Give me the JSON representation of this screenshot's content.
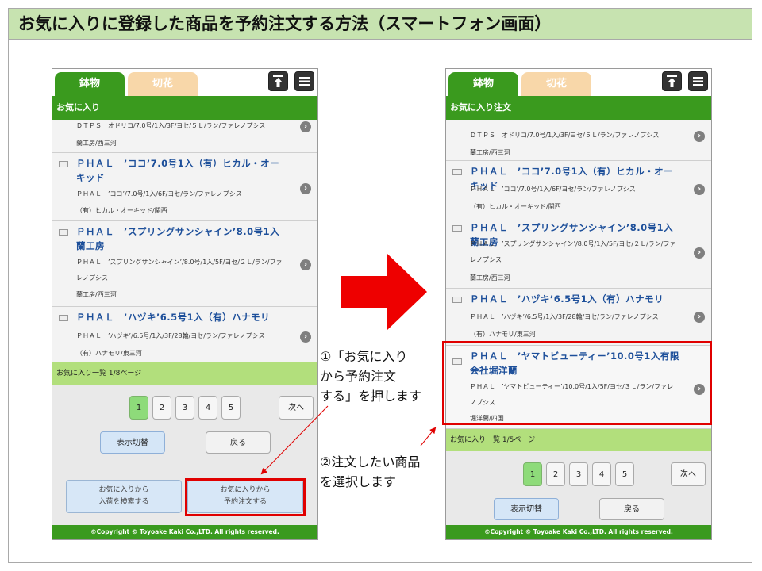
{
  "title": "お気に入りに登録した商品を予約注文する方法（スマートフォン画面）",
  "colors": {
    "green": "#3a9a1e",
    "light_green": "#b2df7c",
    "orange_tab": "#f8d7a9",
    "link_blue": "#1d4f9a",
    "red": "#e00000"
  },
  "annotations": {
    "step1": [
      "①「お気に入り",
      "から予約注文",
      "する」を押します"
    ],
    "step2": [
      "②注文したい商品",
      "を選択します"
    ]
  },
  "left_screen": {
    "tabs": [
      "鉢物",
      "切花"
    ],
    "icons": [
      "arrow-up-icon",
      "menu-icon"
    ],
    "section_title": "お気に入り",
    "items": [
      {
        "title": "",
        "lines": [
          "ＤＴＰＳ　オドリコ/7.0号/1入/3F/ヨセ/５Ｌ/ラン/ファレノプシス",
          "蘭工房/西三河"
        ]
      },
      {
        "title": "ＰＨＡＬ　’ココ’7.0号1入（有）ヒカル・オーキッド",
        "lines": [
          "ＰＨＡＬ　’ココ’/7.0号/1入/6F/ヨセ/ラン/ファレノプシス",
          "（有）ヒカル・オーキッド/関西"
        ]
      },
      {
        "title": "ＰＨＡＬ　’スプリングサンシャイン’8.0号1入蘭工房",
        "lines": [
          "ＰＨＡＬ　’スプリングサンシャイン’/8.0号/1入/5F/ヨセ/２Ｌ/ラン/ファレノプシス",
          "蘭工房/西三河"
        ]
      },
      {
        "title": "ＰＨＡＬ　’ハヅキ’6.5号1入（有）ハナモリ",
        "lines": [
          "ＰＨＡＬ　’ハヅキ’/6.5号/1入/3F/28輪/ヨセ/ラン/ファレノプシス",
          "（有）ハナモリ/東三河"
        ]
      }
    ],
    "page_info": "お気に入り一覧 1/8ページ",
    "pages": [
      "1",
      "2",
      "3",
      "4",
      "5"
    ],
    "next": "次へ",
    "toggle_btn": "表示切替",
    "back_btn": "戻る",
    "search_btn": [
      "お気に入りから",
      "入荷を検索する"
    ],
    "order_btn": [
      "お気に入りから",
      "予約注文する"
    ],
    "copyright": "©Copyright © Toyoake Kaki Co.,LTD. All rights reserved."
  },
  "right_screen": {
    "tabs": [
      "鉢物",
      "切花"
    ],
    "icons": [
      "arrow-up-icon",
      "menu-icon"
    ],
    "section_title": "お気に入り注文",
    "items": [
      {
        "title": "",
        "lines": [
          "ＤＴＰＳ　オドリコ/7.0号/1入/3F/ヨセ/５Ｌ/ラン/ファレノプシス",
          "蘭工房/西三河"
        ]
      },
      {
        "title": "ＰＨＡＬ　’ココ’7.0号1入（有）ヒカル・オーキッド",
        "lines": [
          "ＰＨＡＬ　’ココ’/7.0号/1入/6F/ヨセ/ラン/ファレノプシス",
          "（有）ヒカル・オーキッド/関西"
        ]
      },
      {
        "title": "ＰＨＡＬ　’スプリングサンシャイン’8.0号1入蘭工房",
        "lines": [
          "ＰＨＡＬ　’スプリングサンシャイン’/8.0号/1入/5F/ヨセ/２Ｌ/ラン/ファレノプシス",
          "蘭工房/西三河"
        ]
      },
      {
        "title": "ＰＨＡＬ　’ハヅキ’6.5号1入（有）ハナモリ",
        "lines": [
          "ＰＨＡＬ　’ハヅキ’/6.5号/1入/3F/28輪/ヨセ/ラン/ファレノプシス",
          "（有）ハナモリ/東三河"
        ]
      },
      {
        "title": "ＰＨＡＬ　’ヤマトビューティー’10.0号1入有限会社堀洋蘭",
        "lines": [
          "ＰＨＡＬ　’ヤマトビューティー’/10.0号/1入/5F/ヨセ/３Ｌ/ラン/ファレノプシス",
          "堀洋蘭/四国"
        ]
      }
    ],
    "page_info": "お気に入り一覧 1/5ページ",
    "pages": [
      "1",
      "2",
      "3",
      "4",
      "5"
    ],
    "next": "次へ",
    "toggle_btn": "表示切替",
    "back_btn": "戻る",
    "copyright": "©Copyright © Toyoake Kaki Co.,LTD. All rights reserved."
  }
}
